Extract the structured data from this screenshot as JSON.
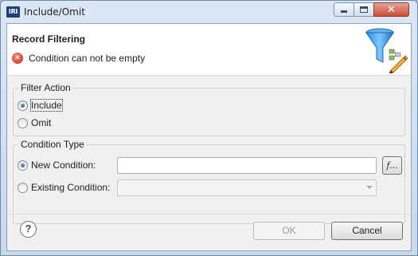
{
  "window": {
    "icon_text": "IRI",
    "title": "Include/Omit",
    "controls": {
      "minimize": "minimize",
      "maximize": "maximize",
      "close": "✕"
    }
  },
  "banner": {
    "title": "Record Filtering",
    "error_message": "Condition can not be empty",
    "error_icon": "error-x-icon",
    "graphic_icon": "funnel-filter-icon"
  },
  "filter_action": {
    "legend": "Filter Action",
    "options": [
      {
        "label": "Include",
        "selected": true
      },
      {
        "label": "Omit",
        "selected": false
      }
    ]
  },
  "condition_type": {
    "legend": "Condition Type",
    "new_condition": {
      "label": "New Condition:",
      "selected": true,
      "value": ""
    },
    "function_button": "f...",
    "existing_condition": {
      "label": "Existing Condition:",
      "selected": false,
      "value": ""
    }
  },
  "footer": {
    "help_symbol": "?",
    "ok_label": "OK",
    "ok_enabled": false,
    "cancel_label": "Cancel"
  }
}
